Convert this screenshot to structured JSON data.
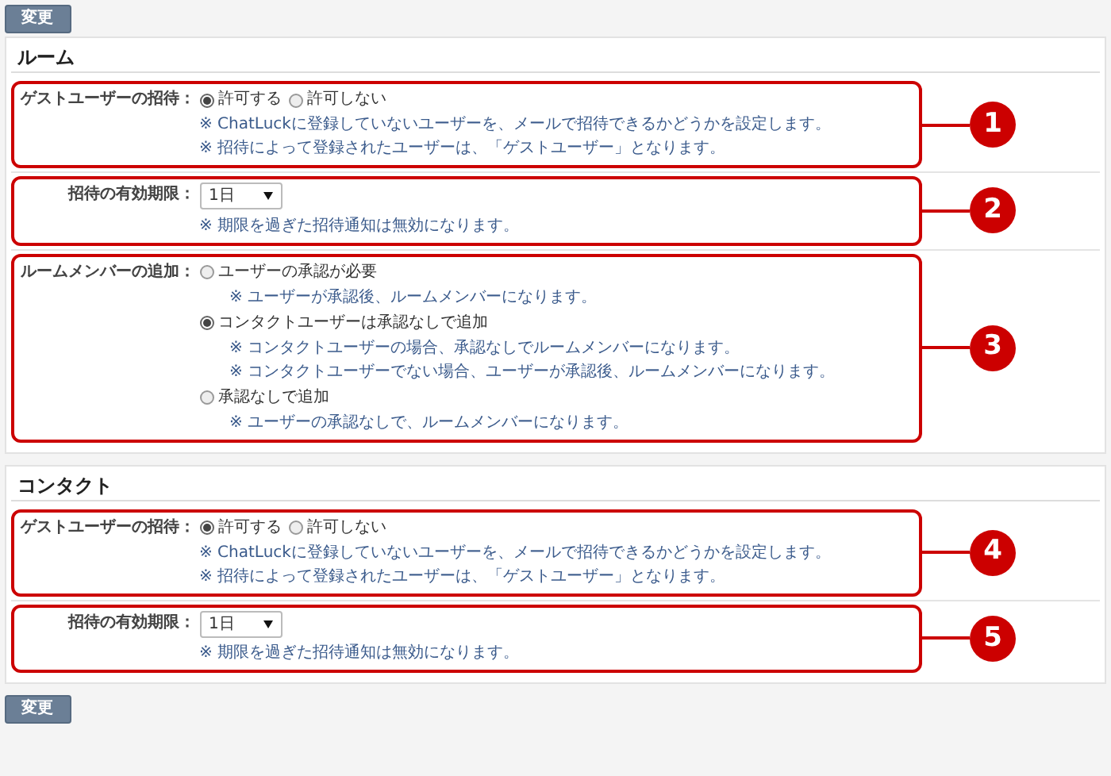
{
  "top_button": "変更",
  "sections": [
    {
      "title": "ルーム",
      "rows": [
        {
          "kind": "radio-inline",
          "label": "ゲストユーザーの招待：",
          "callout": "1",
          "options": [
            {
              "label": "許可する",
              "selected": true
            },
            {
              "label": "許可しない",
              "selected": false
            }
          ],
          "notes": [
            "※ ChatLuckに登録していないユーザーを、メールで招待できるかどうかを設定します。",
            "※ 招待によって登録されたユーザーは、「ゲストユーザー」となります。"
          ]
        },
        {
          "kind": "select",
          "label": "招待の有効期限：",
          "callout": "2",
          "value": "1日",
          "notes": [
            "※ 期限を過ぎた招待通知は無効になります。"
          ]
        },
        {
          "kind": "radio-stack",
          "label": "ルームメンバーの追加：",
          "callout": "3",
          "options": [
            {
              "label": "ユーザーの承認が必要",
              "selected": false,
              "notes": [
                "※ ユーザーが承認後、ルームメンバーになります。"
              ]
            },
            {
              "label": "コンタクトユーザーは承認なしで追加",
              "selected": true,
              "notes": [
                "※ コンタクトユーザーの場合、承認なしでルームメンバーになります。",
                "※ コンタクトユーザーでない場合、ユーザーが承認後、ルームメンバーになります。"
              ]
            },
            {
              "label": "承認なしで追加",
              "selected": false,
              "notes": [
                "※ ユーザーの承認なしで、ルームメンバーになります。"
              ]
            }
          ]
        }
      ]
    },
    {
      "title": "コンタクト",
      "rows": [
        {
          "kind": "radio-inline",
          "label": "ゲストユーザーの招待：",
          "callout": "4",
          "options": [
            {
              "label": "許可する",
              "selected": true
            },
            {
              "label": "許可しない",
              "selected": false
            }
          ],
          "notes": [
            "※ ChatLuckに登録していないユーザーを、メールで招待できるかどうかを設定します。",
            "※ 招待によって登録されたユーザーは、「ゲストユーザー」となります。"
          ]
        },
        {
          "kind": "select",
          "label": "招待の有効期限：",
          "callout": "5",
          "value": "1日",
          "notes": [
            "※ 期限を過ぎた招待通知は無効になります。"
          ]
        }
      ]
    }
  ],
  "bottom_button": "変更"
}
